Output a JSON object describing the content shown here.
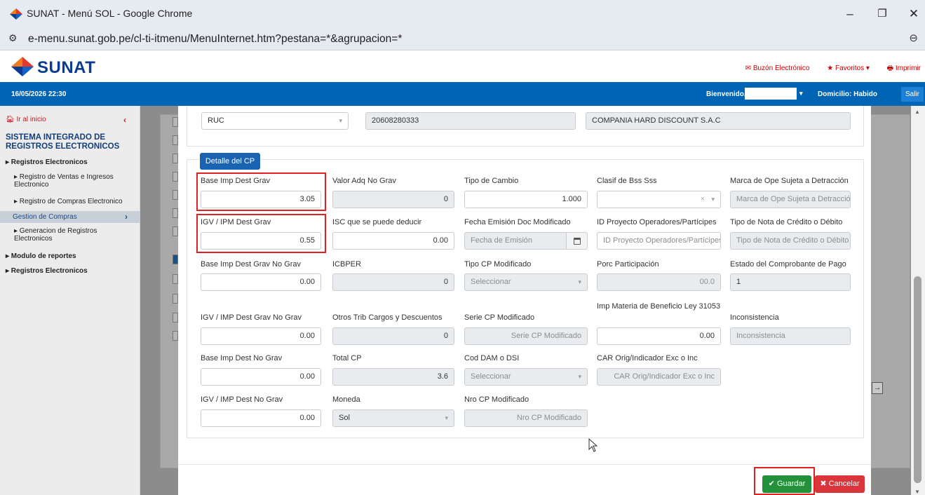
{
  "browser": {
    "title": "SUNAT - Menú SOL - Google Chrome",
    "url": "e-menu.sunat.gob.pe/cl-ti-itmenu/MenuInternet.htm?pestana=*&agrupacion=*",
    "minimize": "–",
    "restore": "❐",
    "close": "✕",
    "zoom_icon": "⊖"
  },
  "header": {
    "logo_text": "SUNAT",
    "links": [
      "✉ Buzón Electrónico",
      "★ Favoritos ▾",
      "🖶 Imprimir"
    ],
    "date": "16/05/2026 22:30",
    "welcome": "Bienvenido,",
    "domicile": "Domicilio: Habido",
    "logout": "Salir"
  },
  "sidebar": {
    "home": "Ir al inicio",
    "system_title": "SISTEMA INTEGRADO DE REGISTROS ELECTRONICOS",
    "items": [
      "▸ Registros Electronicos",
      "▸ Registro de Ventas e Ingresos Electronico",
      "▸ Registro de Compras Electronico",
      "Gestion de Compras",
      "▸ Generacion de Registros Electronicos",
      "▸ Modulo de reportes",
      "▸ Registros Electronicos"
    ]
  },
  "top_fields": {
    "doc_type": "RUC",
    "ruc": "20608280333",
    "company": "COMPANIA HARD DISCOUNT S.A.C"
  },
  "detail": {
    "tab": "Detalle del CP",
    "fields": {
      "base_imp_dest_grav": {
        "label": "Base Imp Dest Grav",
        "value": "3.05"
      },
      "valor_adq_no_grav": {
        "label": "Valor Adq No Grav",
        "value": "0"
      },
      "tipo_cambio": {
        "label": "Tipo de Cambio",
        "value": "1.000"
      },
      "clasif_bss": {
        "label": "Clasif de Bss Sss",
        "value": ""
      },
      "marca_detraccion": {
        "label": "Marca de Ope Sujeta a Detracción",
        "placeholder": "Marca de Ope Sujeta a Detracción"
      },
      "igv_ipm_dest_grav": {
        "label": "IGV / IPM Dest Grav",
        "value": "0.55"
      },
      "isc": {
        "label": "ISC que se puede deducir",
        "value": "0.00"
      },
      "fecha_emision_mod": {
        "label": "Fecha Emisión Doc Modificado",
        "placeholder": "Fecha de Emisión"
      },
      "id_proyecto": {
        "label": "ID Proyecto Operadores/Partícipes",
        "placeholder": "ID Proyecto Operadores/Partícipes"
      },
      "tipo_nota": {
        "label": "Tipo de Nota de Crédito o Débito",
        "placeholder": "Tipo de Nota de Crédito o Débito"
      },
      "base_imp_grav_no_grav": {
        "label": "Base Imp Dest Grav No Grav",
        "value": "0.00"
      },
      "icbper": {
        "label": "ICBPER",
        "value": "0"
      },
      "tipo_cp_mod": {
        "label": "Tipo CP Modificado",
        "value": "Seleccionar"
      },
      "porc_participacion": {
        "label": "Porc Participación",
        "value": "00.0"
      },
      "estado_comprobante": {
        "label": "Estado del Comprobante de Pago",
        "value": "1"
      },
      "igv_grav_no_grav": {
        "label": "IGV / IMP Dest Grav No Grav",
        "value": "0.00"
      },
      "otros_trib": {
        "label": "Otros Trib Cargos y Descuentos",
        "value": "0"
      },
      "serie_cp_mod": {
        "label": "Serie CP Modificado",
        "placeholder": "Serie CP Modificado"
      },
      "imp_materia": {
        "label": "Imp Materia de Beneficio Ley 31053",
        "value": "0.00"
      },
      "inconsistencia": {
        "label": "Inconsistencia",
        "placeholder": "Inconsistencia"
      },
      "base_imp_no_grav": {
        "label": "Base Imp Dest No Grav",
        "value": "0.00"
      },
      "total_cp": {
        "label": "Total CP",
        "value": "3.6"
      },
      "cod_dam": {
        "label": "Cod DAM o DSI",
        "value": "Seleccionar"
      },
      "car_orig": {
        "label": "CAR Orig/Indicador Exc o Inc",
        "placeholder": "CAR Orig/Indicador Exc o Inc"
      },
      "igv_no_grav": {
        "label": "IGV / IMP Dest No Grav",
        "value": "0.00"
      },
      "moneda": {
        "label": "Moneda",
        "value": "Sol"
      },
      "nro_cp_mod": {
        "label": "Nro CP Modificado",
        "placeholder": "Nro  CP Modificado"
      }
    }
  },
  "actions": {
    "save": "✔ Guardar",
    "cancel": "✖ Cancelar"
  },
  "colors": {
    "brand_blue": "#0064b4",
    "highlight": "#e02121",
    "save": "#23903a",
    "cancel": "#d9353b"
  }
}
